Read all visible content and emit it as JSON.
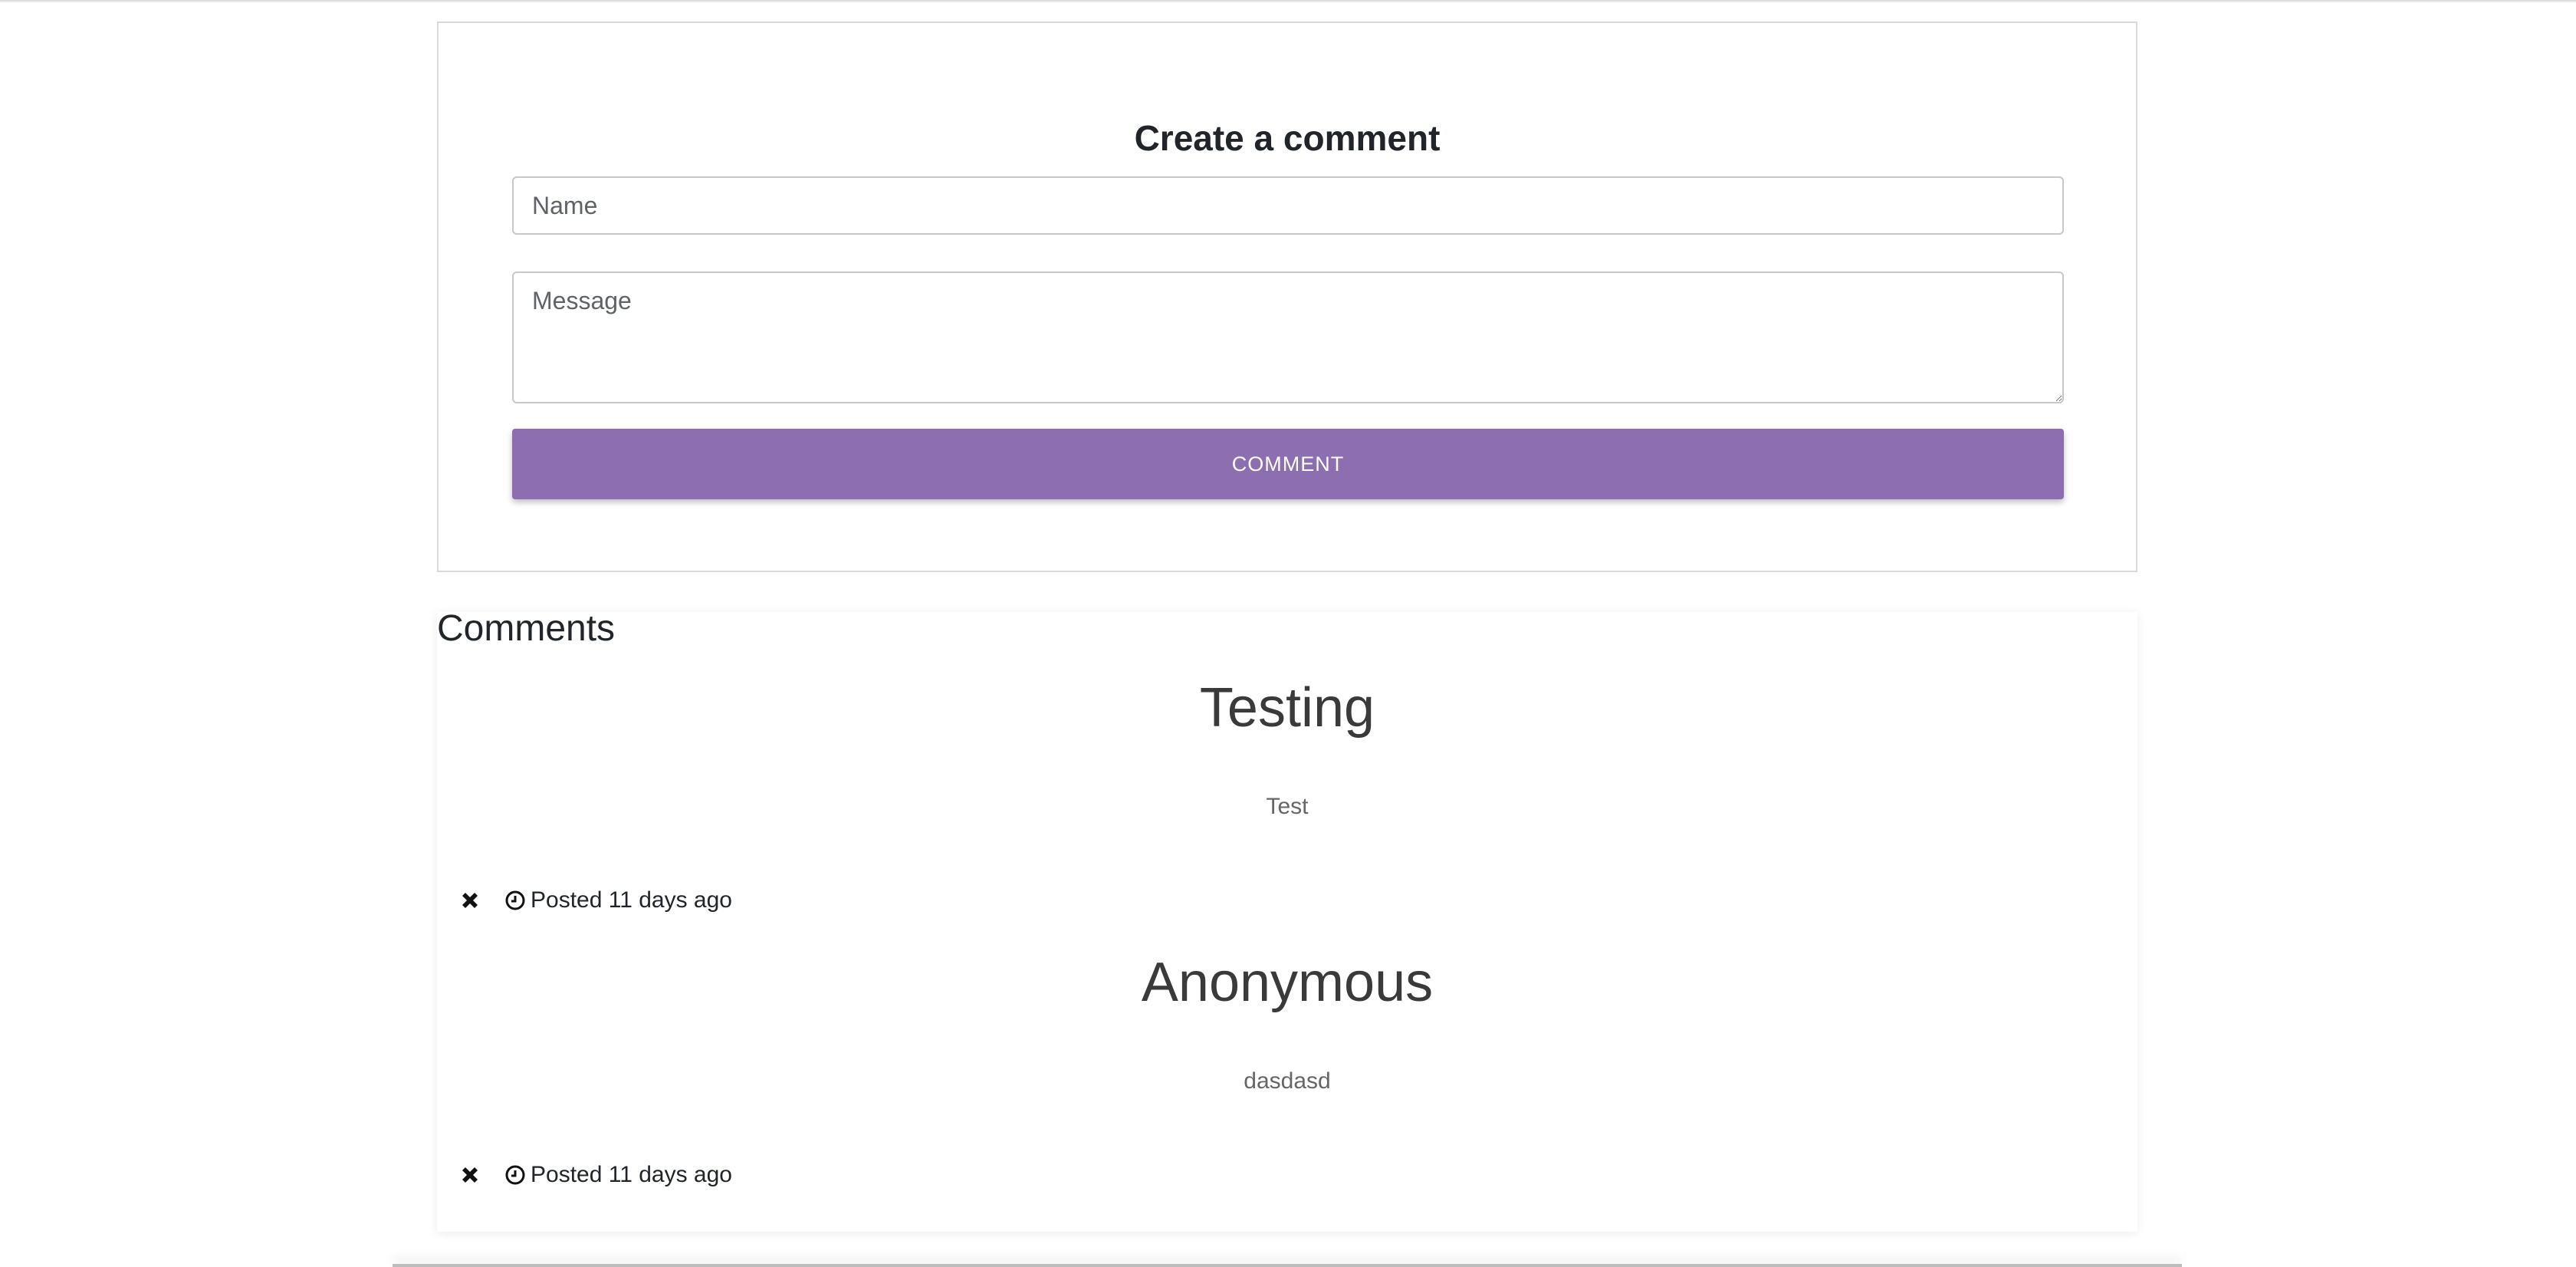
{
  "form": {
    "title": "Create a comment",
    "name_placeholder": "Name",
    "name_value": "",
    "message_placeholder": "Message",
    "message_value": "",
    "submit_label": "COMMENT",
    "accent_color": "#8d6eb0"
  },
  "comments": {
    "heading": "Comments",
    "items": [
      {
        "author": "Testing",
        "message": "Test",
        "posted": "Posted 11 days ago",
        "delete_icon": "close-icon",
        "time_icon": "clock-icon"
      },
      {
        "author": "Anonymous",
        "message": "dasdasd",
        "posted": "Posted 11 days ago",
        "delete_icon": "close-icon",
        "time_icon": "clock-icon"
      }
    ]
  }
}
